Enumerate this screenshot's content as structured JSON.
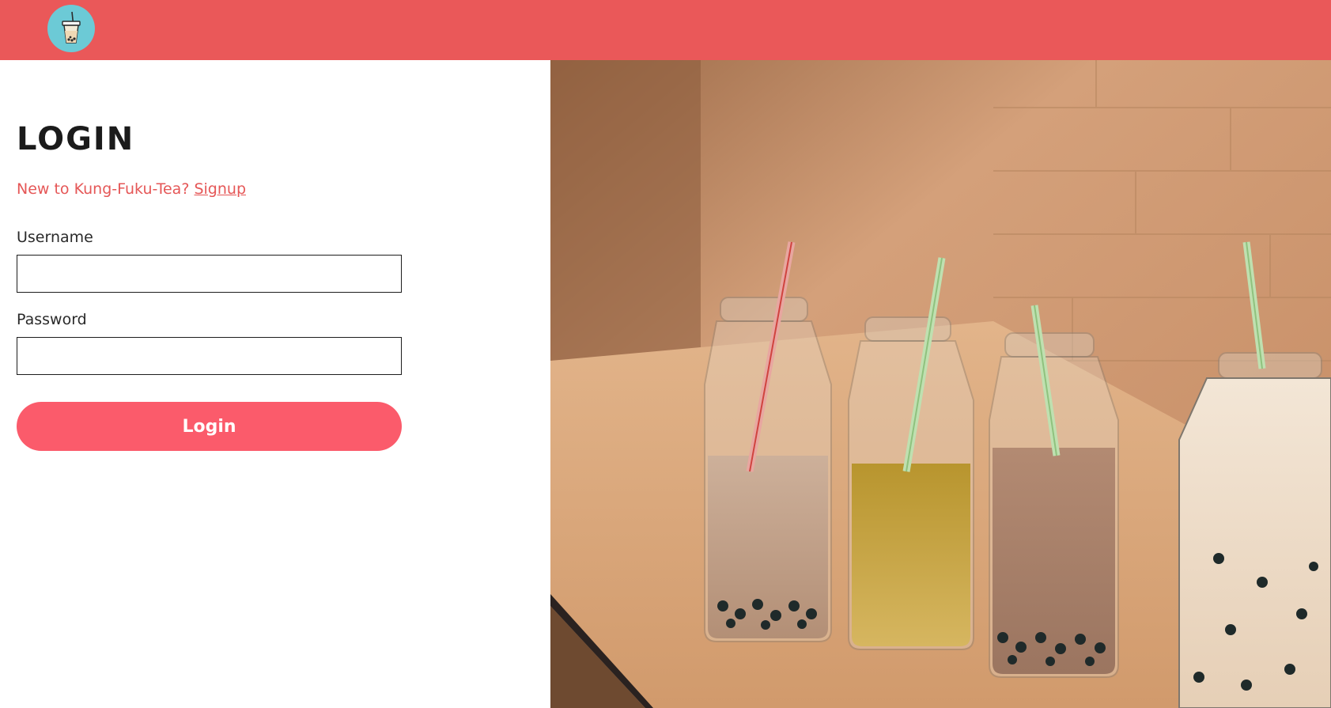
{
  "header": {
    "logo_icon": "bubble-tea-icon",
    "logo_color": "#6ccad6",
    "bar_color": "#ea5859"
  },
  "login": {
    "title": "LOGIN",
    "signup_prompt": "New to Kung-Fuku-Tea?",
    "signup_link": "Signup",
    "username_label": "Username",
    "username_value": "",
    "password_label": "Password",
    "password_value": "",
    "submit_label": "Login",
    "accent_color": "#fb5b6b"
  },
  "hero_image": {
    "subject": "bubble-tea-bottles-photo"
  }
}
